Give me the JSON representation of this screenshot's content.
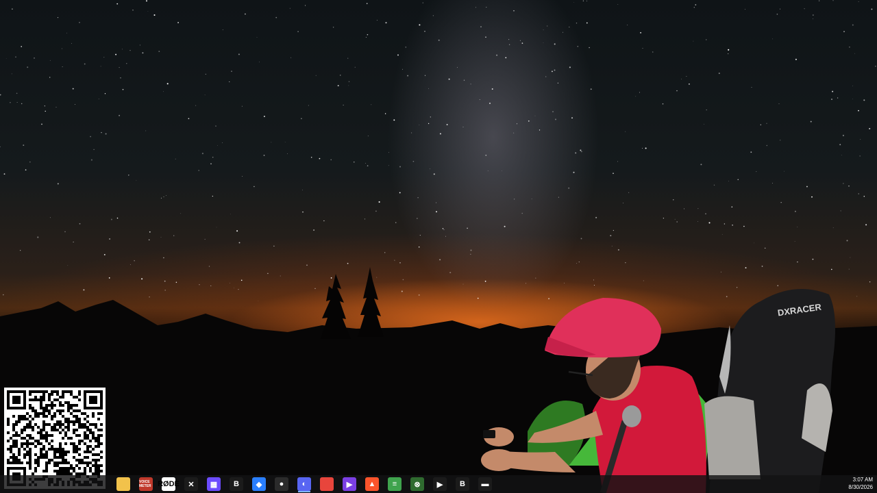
{
  "desktop": {
    "wallpaper": "night-sky-milky-way-mountains"
  },
  "webcam": {
    "chair_brand": "DXRACER"
  },
  "taskbar": {
    "icons": [
      {
        "name": "file-explorer-icon",
        "label": "",
        "color": "#f2c24b"
      },
      {
        "name": "voicemeeter-icon",
        "label": "VOICE METER",
        "color": "#c0392b"
      },
      {
        "name": "rode-icon",
        "label": "RØDE",
        "color": "#ffffff"
      },
      {
        "name": "capcut-icon",
        "label": "✕",
        "color": "#1b1b1b"
      },
      {
        "name": "app-grid-icon",
        "label": "▦",
        "color": "#6c4cff"
      },
      {
        "name": "bold-b-icon",
        "label": "B",
        "color": "#1b1b1b"
      },
      {
        "name": "diamond-app-icon",
        "label": "◆",
        "color": "#2a7fff"
      },
      {
        "name": "obs-icon",
        "label": "●",
        "color": "#2b2b2b"
      },
      {
        "name": "discord-icon",
        "label": "◐",
        "color": "#5865f2"
      },
      {
        "name": "chrome-icon",
        "label": "",
        "color": "#e8453c"
      },
      {
        "name": "clapper-icon",
        "label": "▶",
        "color": "#7b3fe4"
      },
      {
        "name": "brave-icon",
        "label": "▲",
        "color": "#fb542b"
      },
      {
        "name": "stack-app-icon",
        "label": "≡",
        "color": "#3fa34d"
      },
      {
        "name": "xbox-icon",
        "label": "⊗",
        "color": "#2f6b2f"
      },
      {
        "name": "play-arrow-icon",
        "label": "▶",
        "color": "#1b1b1b"
      },
      {
        "name": "b-app-icon",
        "label": "B",
        "color": "#1b1b1b"
      },
      {
        "name": "terminal-icon",
        "label": "▬",
        "color": "#1b1b1b"
      }
    ],
    "clock": {
      "time": "3:07 AM",
      "date": "8/30/2026"
    }
  }
}
